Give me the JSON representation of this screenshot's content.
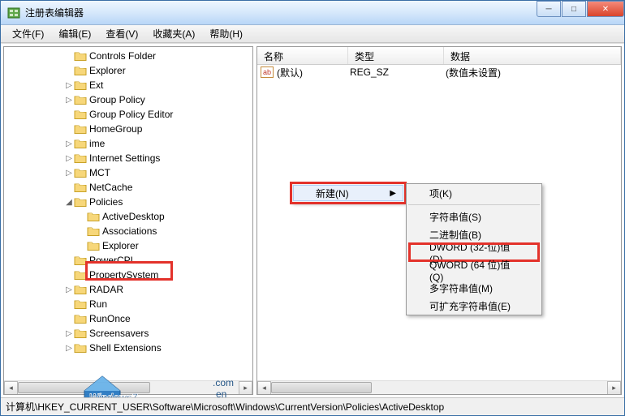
{
  "titlebar": {
    "title": "注册表编辑器"
  },
  "menubar": [
    {
      "label": "文件(F)"
    },
    {
      "label": "编辑(E)"
    },
    {
      "label": "查看(V)"
    },
    {
      "label": "收藏夹(A)"
    },
    {
      "label": "帮助(H)"
    }
  ],
  "tree": [
    {
      "depth": 2,
      "label": "Controls Folder",
      "arrow": ""
    },
    {
      "depth": 2,
      "label": "Explorer",
      "arrow": ""
    },
    {
      "depth": 2,
      "label": "Ext",
      "arrow": "▷"
    },
    {
      "depth": 2,
      "label": "Group Policy",
      "arrow": "▷"
    },
    {
      "depth": 2,
      "label": "Group Policy Editor",
      "arrow": ""
    },
    {
      "depth": 2,
      "label": "HomeGroup",
      "arrow": ""
    },
    {
      "depth": 2,
      "label": "ime",
      "arrow": "▷"
    },
    {
      "depth": 2,
      "label": "Internet Settings",
      "arrow": "▷"
    },
    {
      "depth": 2,
      "label": "MCT",
      "arrow": "▷"
    },
    {
      "depth": 2,
      "label": "NetCache",
      "arrow": ""
    },
    {
      "depth": 2,
      "label": "Policies",
      "arrow": "◢"
    },
    {
      "depth": 3,
      "label": "ActiveDesktop",
      "arrow": "",
      "selected": true
    },
    {
      "depth": 3,
      "label": "Associations",
      "arrow": ""
    },
    {
      "depth": 3,
      "label": "Explorer",
      "arrow": ""
    },
    {
      "depth": 2,
      "label": "PowerCPL",
      "arrow": ""
    },
    {
      "depth": 2,
      "label": "PropertySystem",
      "arrow": ""
    },
    {
      "depth": 2,
      "label": "RADAR",
      "arrow": "▷"
    },
    {
      "depth": 2,
      "label": "Run",
      "arrow": ""
    },
    {
      "depth": 2,
      "label": "RunOnce",
      "arrow": ""
    },
    {
      "depth": 2,
      "label": "Screensavers",
      "arrow": "▷"
    },
    {
      "depth": 2,
      "label": "Shell Extensions",
      "arrow": "▷"
    }
  ],
  "list": {
    "headers": {
      "name": "名称",
      "type": "类型",
      "data": "数据"
    },
    "rows": [
      {
        "icon": "ab",
        "name": "(默认)",
        "type": "REG_SZ",
        "data": "(数值未设置)"
      }
    ]
  },
  "context_primary": {
    "label": "新建(N)"
  },
  "context_secondary": [
    {
      "label": "项(K)"
    },
    {
      "sep": true
    },
    {
      "label": "字符串值(S)"
    },
    {
      "label": "二进制值(B)"
    },
    {
      "label": "DWORD (32-位)值(D)",
      "highlighted": true
    },
    {
      "label": "QWORD (64 位)值(Q)"
    },
    {
      "label": "多字符串值(M)"
    },
    {
      "label": "可扩充字符串值(E)"
    }
  ],
  "statusbar": "计算机\\HKEY_CURRENT_USER\\Software\\Microsoft\\Windows\\CurrentVersion\\Policies\\ActiveDesktop"
}
